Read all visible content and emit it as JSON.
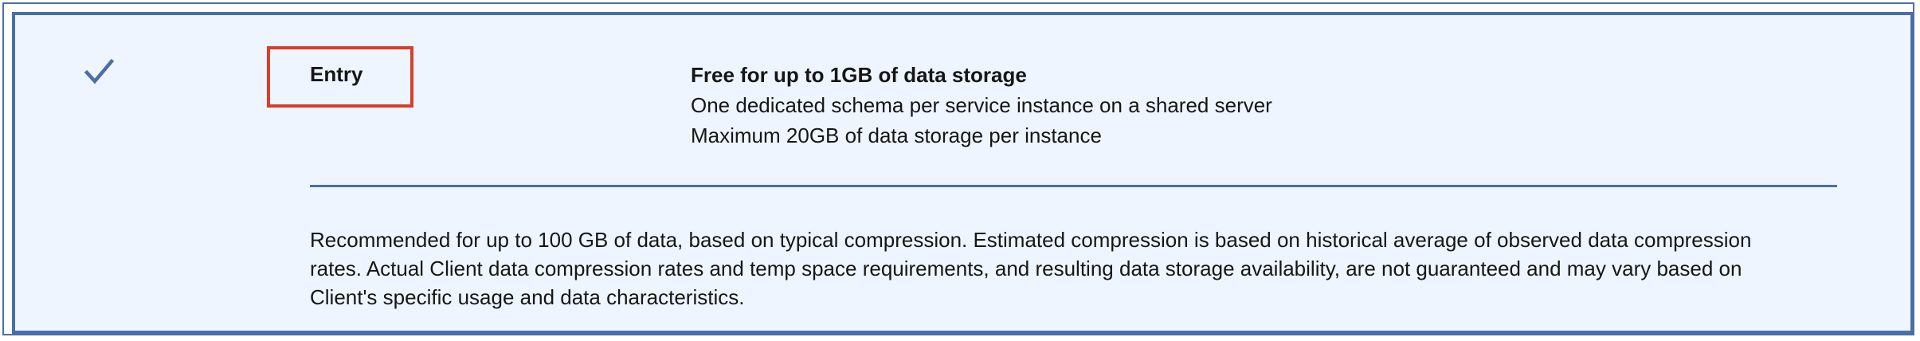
{
  "plan": {
    "selected": true,
    "name": "Entry",
    "features": [
      "Free for up to 1GB of data storage",
      "One dedicated schema per service instance on a shared server",
      "Maximum 20GB of data storage per instance"
    ],
    "footnote": "Recommended for up to 100 GB of data, based on typical compression. Estimated compression is based on historical average of observed data compression rates. Actual Client data compression rates and temp space requirements, and resulting data storage availability, are not guaranteed and may vary based on Client's specific usage and data characteristics."
  },
  "icons": {
    "selected_indicator": "checkmark-icon"
  },
  "colors": {
    "tile_background": "#eef5ff",
    "accent_border": "#4a6fa5",
    "highlight_annotation": "#da3d2a"
  }
}
